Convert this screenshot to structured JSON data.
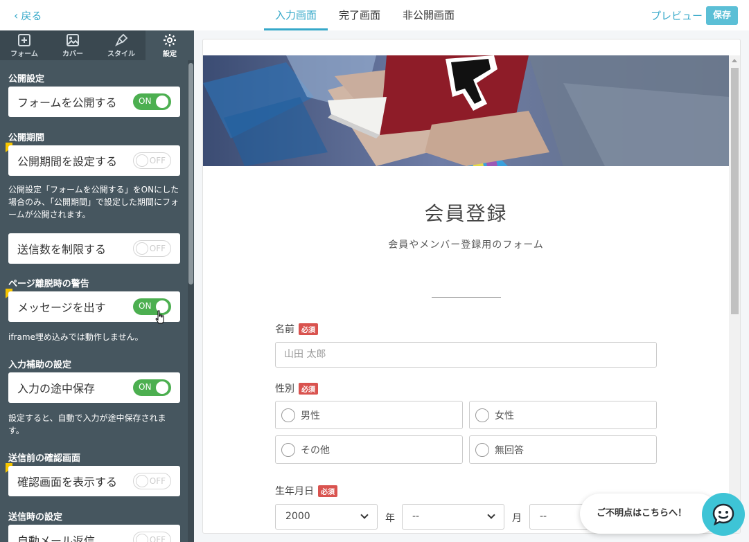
{
  "topbar": {
    "back_label": "戻る",
    "tabs": [
      {
        "label": "入力画面",
        "active": true
      },
      {
        "label": "完了画面",
        "active": false
      },
      {
        "label": "非公開画面",
        "active": false
      }
    ],
    "preview_label": "プレビュー",
    "save_label": "保存"
  },
  "sidebar": {
    "tabs": [
      {
        "label": "フォーム",
        "icon": "plus-square-icon"
      },
      {
        "label": "カバー",
        "icon": "image-icon"
      },
      {
        "label": "スタイル",
        "icon": "brush-icon"
      },
      {
        "label": "設定",
        "icon": "gear-icon",
        "active": true
      }
    ],
    "sections": {
      "publish": {
        "title": "公開設定",
        "label": "フォームを公開する",
        "toggle": "ON"
      },
      "period": {
        "title": "公開期間",
        "label": "公開期間を設定する",
        "toggle": "OFF",
        "note": "公開設定「フォームを公開する」をONにした場合のみ、「公開期間」で設定した期間にフォームが公開されます。"
      },
      "limit": {
        "label": "送信数を制限する",
        "toggle": "OFF"
      },
      "leave_warning": {
        "title": "ページ離脱時の警告",
        "label": "メッセージを出す",
        "toggle": "ON",
        "note": "iframe埋め込みでは動作しません。"
      },
      "input_assist": {
        "title": "入力補助の設定",
        "label": "入力の途中保存",
        "toggle": "ON",
        "note": "設定すると、自動で入力が途中保存されます。"
      },
      "confirm": {
        "title": "送信前の確認画面",
        "label": "確認画面を表示する",
        "toggle": "OFF"
      },
      "on_send": {
        "title": "送信時の設定",
        "label": "自動メール返信",
        "toggle": "OFF"
      }
    }
  },
  "form": {
    "title": "会員登録",
    "subtitle": "会員やメンバー登録用のフォーム",
    "required_badge": "必須",
    "name": {
      "label": "名前",
      "placeholder": "山田 太郎"
    },
    "gender": {
      "label": "性別",
      "options": [
        "男性",
        "女性",
        "その他",
        "無回答"
      ]
    },
    "birthday": {
      "label": "生年月日",
      "year_value": "2000",
      "year_unit": "年",
      "month_value": "--",
      "month_unit": "月",
      "day_value": "--"
    }
  },
  "chat": {
    "label": "ご不明点はこちらへ！"
  },
  "colors": {
    "accent": "#35a8c9",
    "sidebar": "#46565f",
    "toggle_on": "#4caf50",
    "required": "#d9534f",
    "chat": "#3ec4d6"
  }
}
